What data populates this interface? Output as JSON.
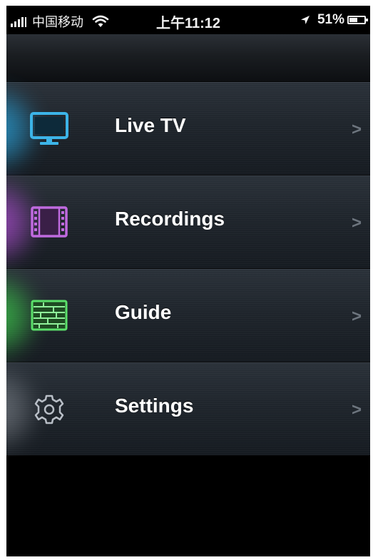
{
  "status_bar": {
    "carrier": "中国移动",
    "time": "上午11:12",
    "battery_percent": "51%",
    "battery_level": 0.51
  },
  "menu": {
    "items": [
      {
        "label": "Live TV",
        "icon": "tv-icon",
        "accent": "#2aa7e0",
        "chevron": ">"
      },
      {
        "label": "Recordings",
        "icon": "film-icon",
        "accent": "#b14fd6",
        "chevron": ">"
      },
      {
        "label": "Guide",
        "icon": "guide-grid-icon",
        "accent": "#3ecf4d",
        "chevron": ">"
      },
      {
        "label": "Settings",
        "icon": "gear-icon",
        "accent": "#9aa0a8",
        "chevron": ">"
      }
    ]
  }
}
